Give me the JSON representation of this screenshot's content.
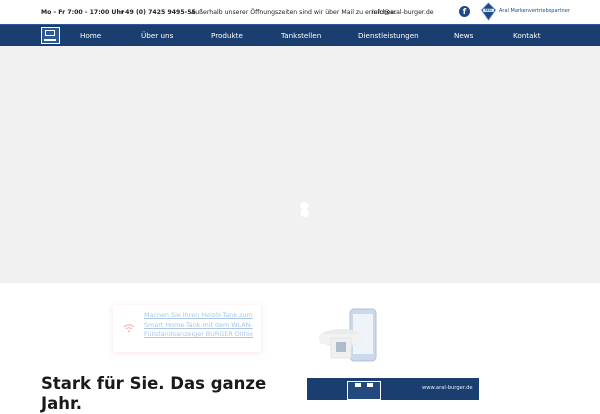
{
  "topbar": {
    "hours": "Mo - Fr 7:00 - 17:00 Uhr",
    "phone": "+49 (0) 7425 9495-55",
    "note": "Außerhalb unserer Öffnungszeiten sind wir über Mail zu erreichen:",
    "email": "info@aral-burger.de",
    "facebook_glyph": "f",
    "partner_label": "Aral Markenvertriebspartner",
    "partner_logo_text": "ARAL"
  },
  "nav": {
    "items": [
      "Home",
      "Über uns",
      "Produkte",
      "Tankstellen",
      "Dienstleistungen",
      "News",
      "Kontakt"
    ]
  },
  "hero": {
    "state": "loading"
  },
  "feature_card": {
    "text": "Machen Sie Ihren Heizöl-Tank zum Smart Home-Tank mit dem WLAN-Füllstandsanzeiger BURGER Oilfox"
  },
  "headline": {
    "text": "Stark für Sie. Das ganze Jahr."
  },
  "promo": {
    "url": "www.aral-burger.de"
  },
  "colors": {
    "navy": "#1b3e71",
    "accent_blue": "#1d4a86",
    "link_blue": "#a9c6e6",
    "wifi_pink": "#f3b8b8",
    "hero_bg": "#f1f1f1"
  },
  "icons": [
    "facebook-icon",
    "aral-logo",
    "site-logo",
    "loading-spinner-icon",
    "wifi-icon",
    "oilfox-device-image",
    "castle-logo"
  ]
}
